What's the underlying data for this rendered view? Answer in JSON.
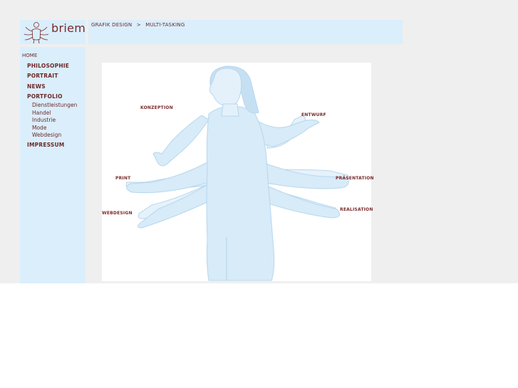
{
  "brand": {
    "name": "briem"
  },
  "breadcrumb": {
    "part1": "GRAFIK DESIGN",
    "separator": ">",
    "part2": "MULTI-TASKING"
  },
  "nav": {
    "home": "HOME",
    "items": [
      "PHILOSOPHIE",
      "PORTRAIT",
      "NEWS",
      "PORTFOLIO"
    ],
    "sub_items": [
      "Dienstleistungen",
      "Handel",
      "Industrie",
      "Mode",
      "Webdesign"
    ],
    "impressum": "IMPRESSUM"
  },
  "illustration": {
    "labels": {
      "konzeption": "KONZEPTION",
      "entwurf": "ENTWURF",
      "print": "PRINT",
      "praesentation": "PRÄSENTATION",
      "webdesign": "WEBDESIGN",
      "realisation": "REALISATION"
    }
  },
  "colors": {
    "panel": "#dbeefb",
    "text": "#6b2a2a",
    "background": "#efefef"
  }
}
